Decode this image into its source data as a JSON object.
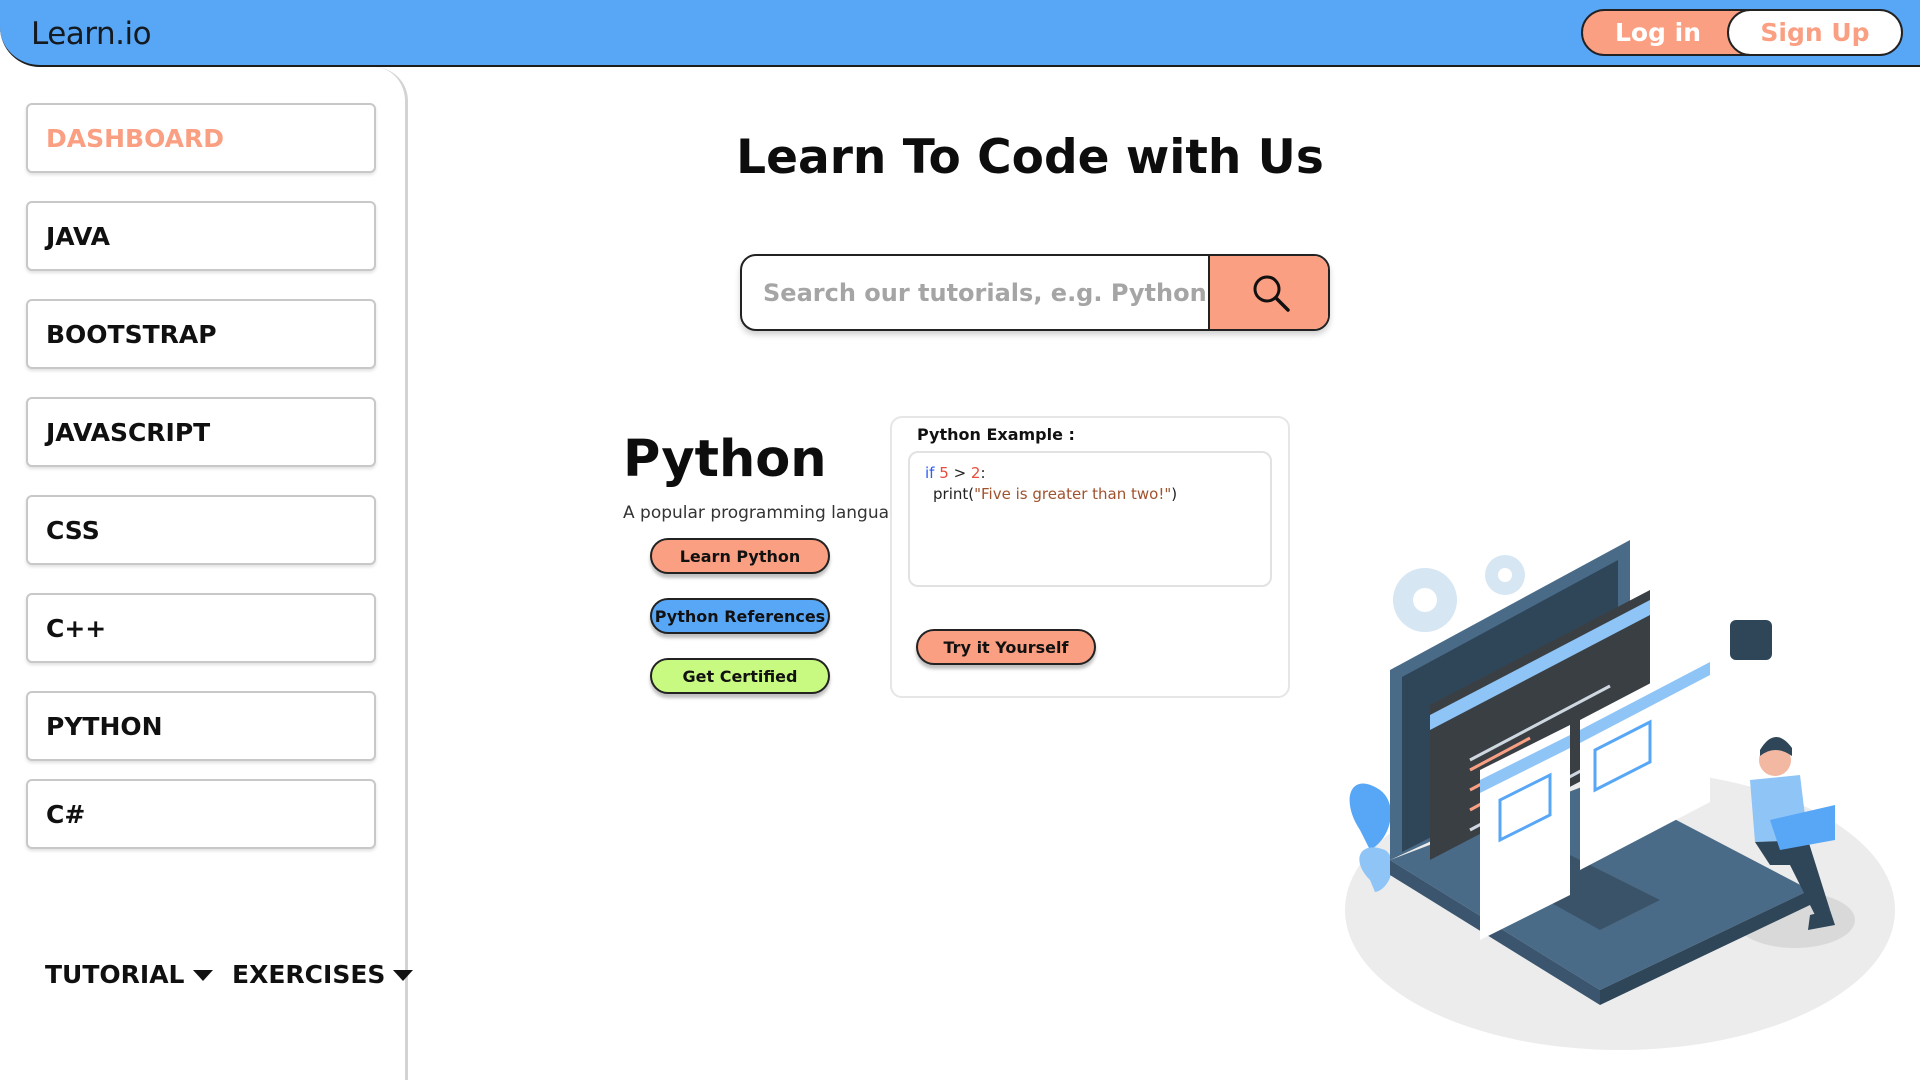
{
  "header": {
    "logo": "Learn.io",
    "login_label": "Log in",
    "signup_label": "Sign Up"
  },
  "sidebar": {
    "items": [
      {
        "label": "DASHBOARD",
        "active": true
      },
      {
        "label": "JAVA"
      },
      {
        "label": "BOOTSTRAP"
      },
      {
        "label": "JAVASCRIPT"
      },
      {
        "label": "CSS"
      },
      {
        "label": "C++"
      },
      {
        "label": "PYTHON"
      },
      {
        "label": "C#"
      }
    ],
    "tutorial_label": "TUTORIAL",
    "exercises_label": "EXERCISES"
  },
  "main": {
    "title": "Learn To Code with Us",
    "search": {
      "placeholder": "Search our tutorials, e.g. Python",
      "icon": "search-icon"
    },
    "language": {
      "title": "Python",
      "subtitle": "A popular programming language",
      "buttons": [
        {
          "label": "Learn Python",
          "color": "#fa9f82"
        },
        {
          "label": "Python References",
          "color": "#58a7f7"
        },
        {
          "label": "Get Certified",
          "color": "#c8fa82"
        }
      ]
    },
    "example": {
      "label": "Python Example :",
      "code": {
        "kw": "if",
        "n1": "5",
        "op": ">",
        "n2": "2",
        "colon": ":",
        "fn_open": "print(",
        "str": "\"Five is greater than two!\"",
        "fn_close": ")"
      },
      "try_label": "Try it Yourself"
    }
  },
  "colors": {
    "header_bg": "#58a7f7",
    "accent": "#fa9f82",
    "blue": "#58a7f7",
    "green": "#c8fa82"
  }
}
